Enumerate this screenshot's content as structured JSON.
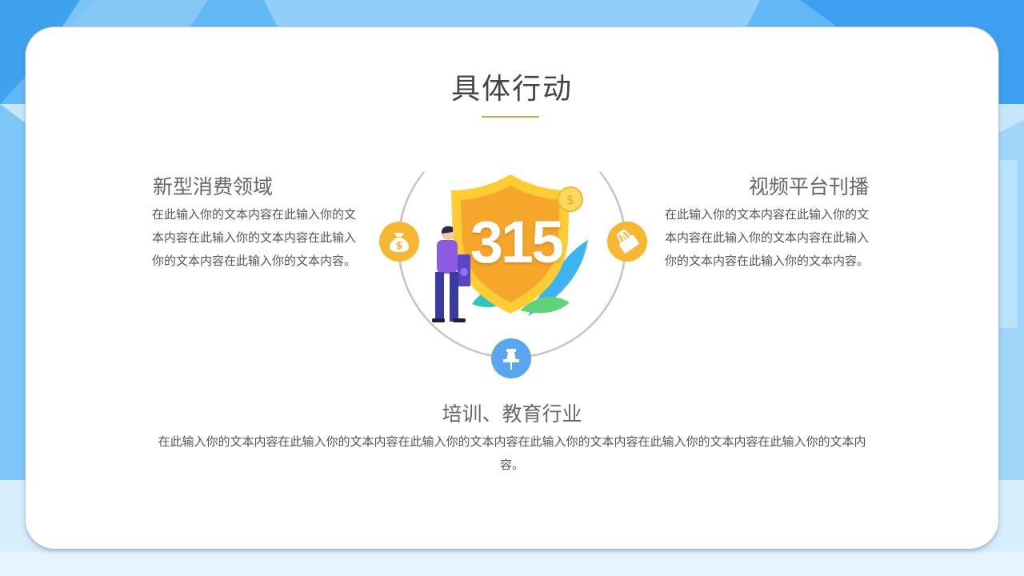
{
  "slide": {
    "title": "具体行动",
    "illustration_number": "315"
  },
  "sections": {
    "left": {
      "heading": "新型消费领域",
      "body": "在此输入你的文本内容在此输入你的文本内容在此输入你的文本内容在此输入你的文本内容在此输入你的文本内容。",
      "icon": "money-bag-icon"
    },
    "right": {
      "heading": "视频平台刊播",
      "body": "在此输入你的文本内容在此输入你的文本内容在此输入你的文本内容在此输入你的文本内容在此输入你的文本内容。",
      "icon": "binder-clip-icon"
    },
    "bottom": {
      "heading": "培训、教育行业",
      "body": "在此输入你的文本内容在此输入你的文本内容在此输入你的文本内容在此输入你的文本内容在此输入你的文本内容在此输入你的文本内容。",
      "icon": "pushpin-icon"
    }
  },
  "colors": {
    "accent_gold": "#d4a84a",
    "badge_orange": "#f7b733",
    "badge_blue": "#5aa5ef",
    "background_blue": "#4aa8f0"
  }
}
